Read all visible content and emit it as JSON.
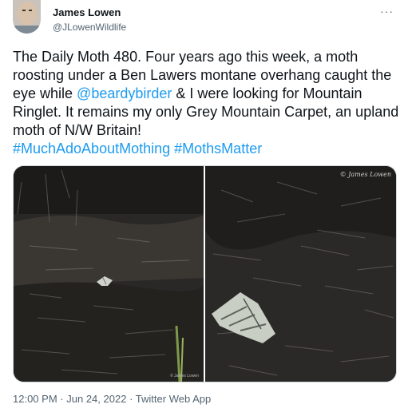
{
  "user": {
    "name": "James Lowen",
    "handle": "@JLowenWildlife"
  },
  "tweet": {
    "text_before": "The Daily Moth 480. Four years ago this week, a moth roosting under a Ben Lawers montane overhang caught the eye while ",
    "mention": "@beardybirder",
    "text_after": " & I were looking for Mountain Ringlet. It remains my only Grey Mountain Carpet, an upland moth of N/W Britain!\n",
    "hashtag1": "#MuchAdoAboutMothing",
    "hashtag2": "#MothsMatter",
    "link_color": "#1d9bf0"
  },
  "media": {
    "right_credit": "© James Lowen",
    "left_credit": "© James Lowen"
  },
  "meta": {
    "time": "12:00 PM",
    "date": "Jun 24, 2022",
    "source": "Twitter Web App",
    "separator": "·"
  },
  "icons": {
    "more": "more-dots-icon"
  }
}
